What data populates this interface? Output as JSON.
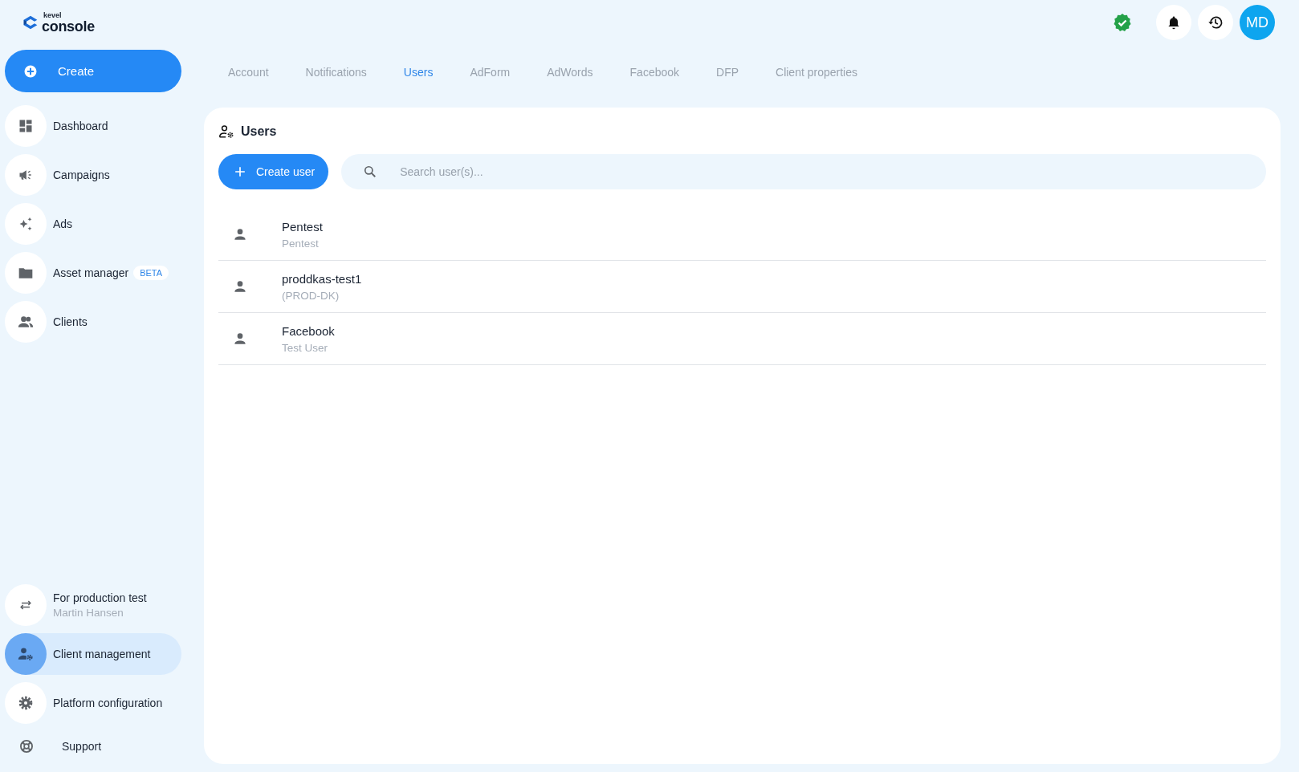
{
  "logo": {
    "brand": "kevel",
    "product": "console"
  },
  "create_button": {
    "label": "Create"
  },
  "sidebar": {
    "items": [
      {
        "label": "Dashboard",
        "selected": false
      },
      {
        "label": "Campaigns",
        "selected": false
      },
      {
        "label": "Ads",
        "selected": false
      },
      {
        "label": "Asset manager",
        "badge": "BETA",
        "selected": false
      },
      {
        "label": "Clients",
        "selected": false
      }
    ],
    "bottom_items": [
      {
        "label": "For production test",
        "subtitle": "Martin Hansen",
        "selected": false
      },
      {
        "label": "Client management",
        "selected": true
      },
      {
        "label": "Platform configuration",
        "selected": false
      }
    ],
    "support": {
      "label": "Support"
    }
  },
  "header": {
    "avatar": "MD"
  },
  "tabs": [
    {
      "label": "Account",
      "selected": false
    },
    {
      "label": "Notifications",
      "selected": false
    },
    {
      "label": "Users",
      "selected": true
    },
    {
      "label": "AdForm",
      "selected": false
    },
    {
      "label": "AdWords",
      "selected": false
    },
    {
      "label": "Facebook",
      "selected": false
    },
    {
      "label": "DFP",
      "selected": false
    },
    {
      "label": "Client properties",
      "selected": false
    }
  ],
  "panel": {
    "title": "Users",
    "create_button": "Create user",
    "search": {
      "placeholder": "Search user(s)..."
    },
    "users": [
      {
        "name": "Pentest",
        "detail": "Pentest"
      },
      {
        "name": "proddkas-test1",
        "detail": "(PROD-DK)"
      },
      {
        "name": "Facebook",
        "detail": "Test User"
      }
    ]
  }
}
